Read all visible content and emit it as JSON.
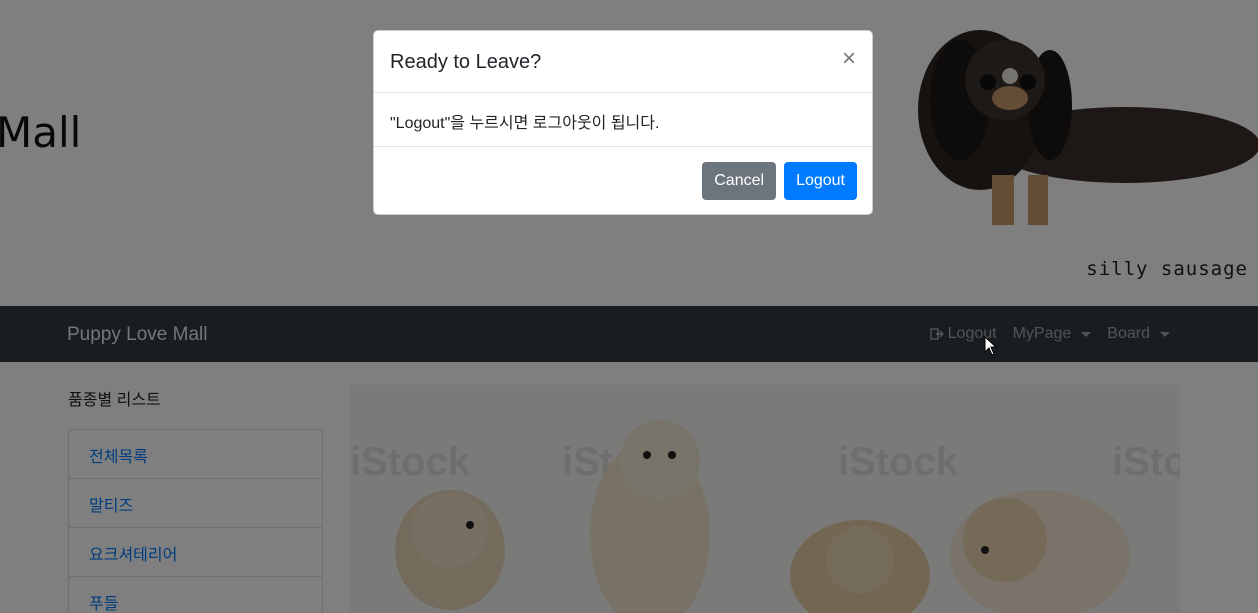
{
  "banner": {
    "title": "Mall",
    "caption": "silly  sausage"
  },
  "navbar": {
    "brand": "Puppy Love Mall",
    "logout": "Logout",
    "mypage": "MyPage",
    "board": "Board"
  },
  "sidebar": {
    "title": "품종별 리스트",
    "items": [
      {
        "label": "전체목록"
      },
      {
        "label": "말티즈"
      },
      {
        "label": "요크셔테리어"
      },
      {
        "label": "푸들"
      }
    ]
  },
  "hero": {
    "watermark": "iStock"
  },
  "modal": {
    "title": "Ready to Leave?",
    "close": "×",
    "body": "\"Logout\"을 누르시면 로그아웃이 됩니다.",
    "cancel": "Cancel",
    "logout": "Logout"
  },
  "colors": {
    "navbar": "#343a40",
    "primary": "#007bff",
    "secondary": "#6c757d",
    "link": "#007bff"
  }
}
